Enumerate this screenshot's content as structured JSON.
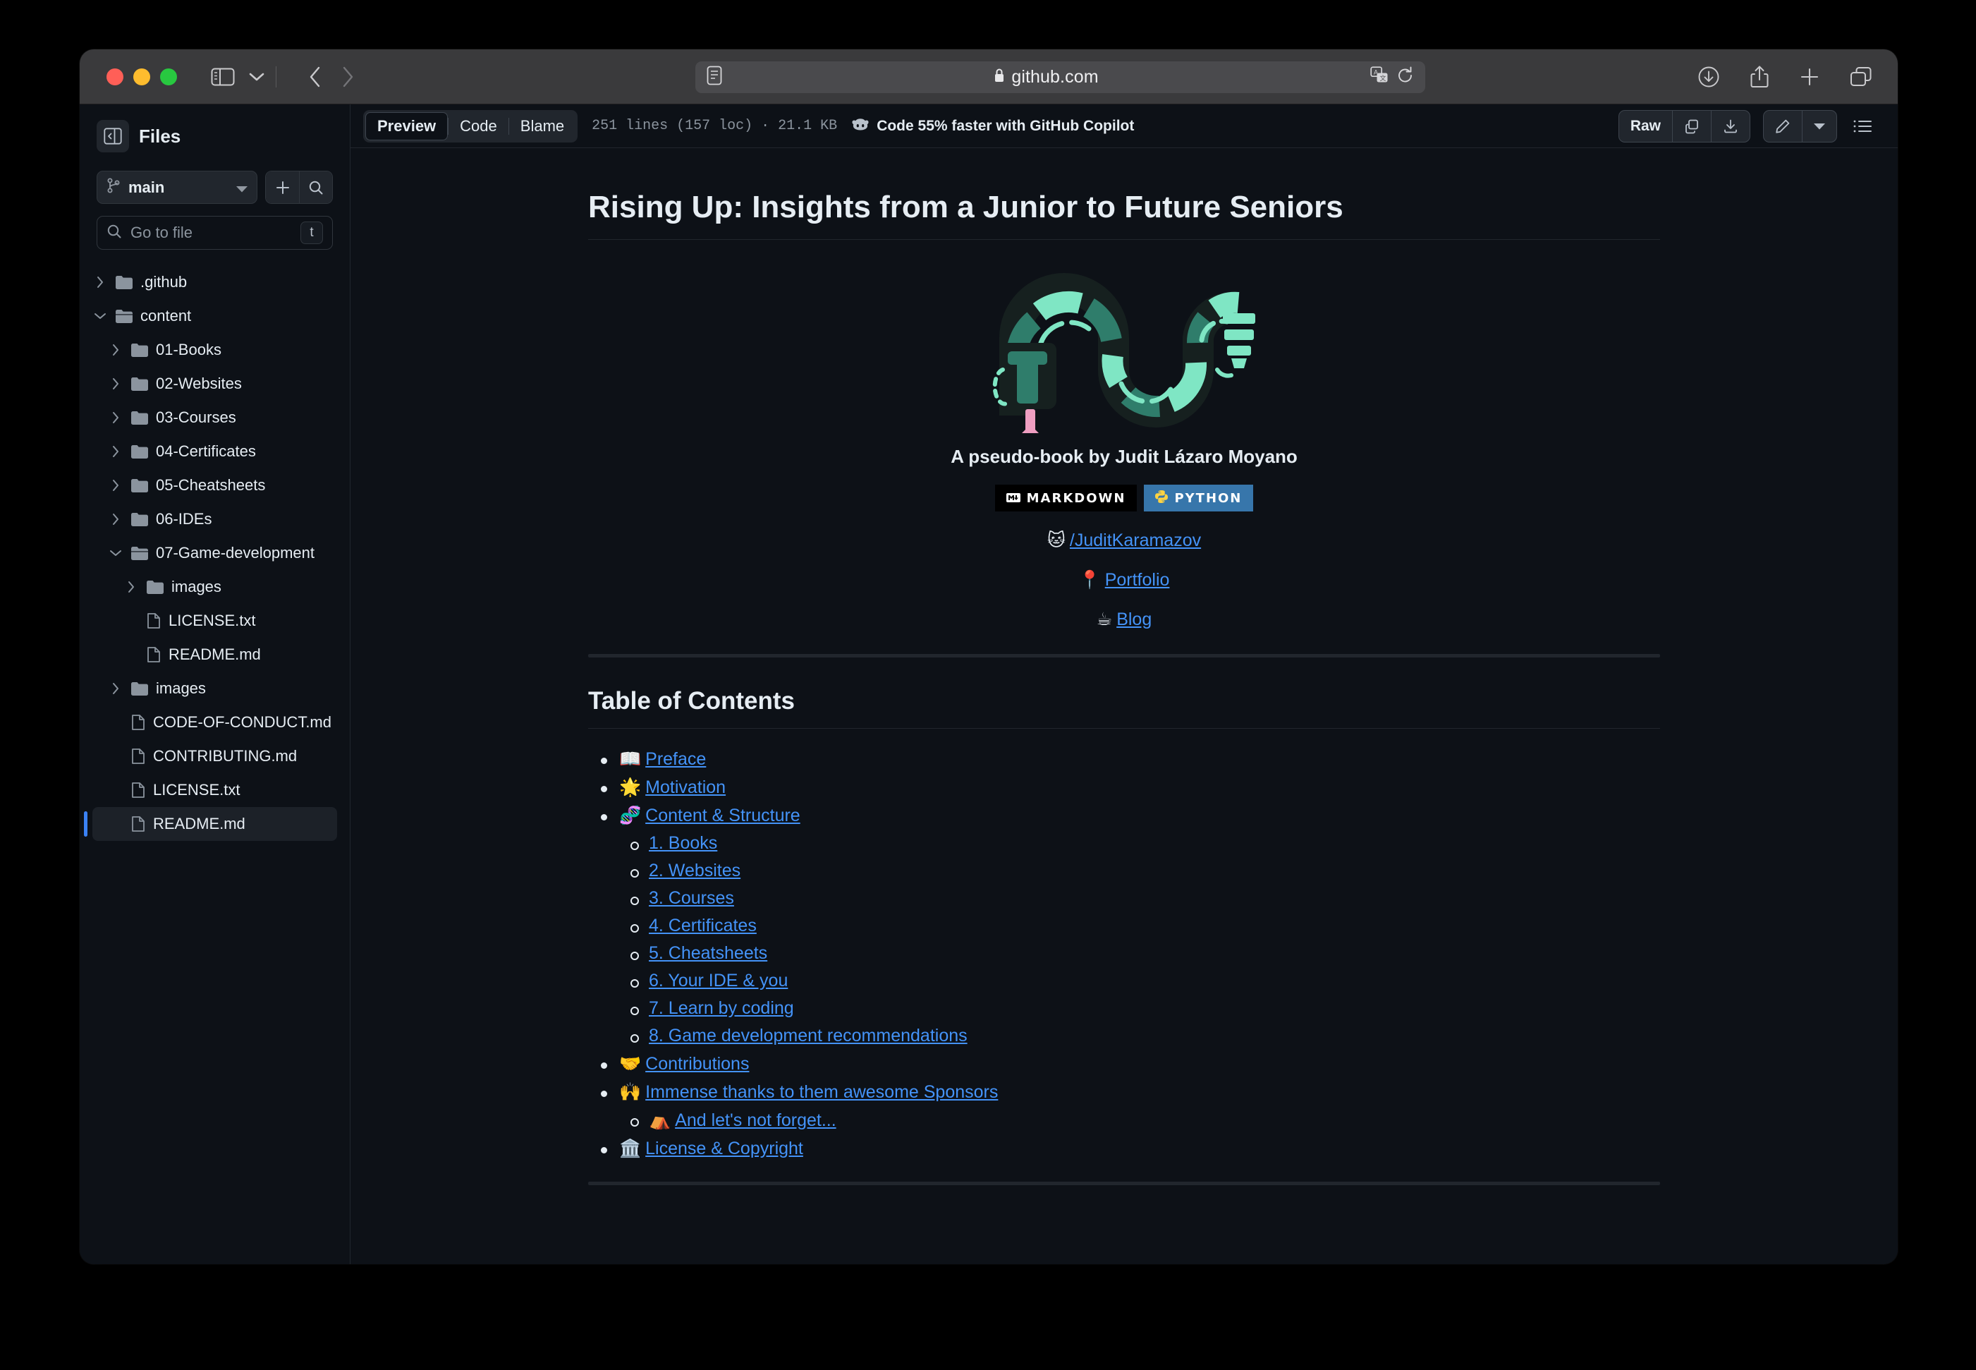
{
  "browser": {
    "url": "github.com",
    "url_lock_icon": "lock-icon",
    "reader_icon": "reader-view-icon",
    "translate_icon": "translate-icon",
    "reload_icon": "reload-icon",
    "sidebar_toggle_icon": "sidebar-toggle-icon",
    "chevron_down_icon": "chevron-down-icon",
    "back_icon": "back-chevron-icon",
    "forward_icon": "forward-chevron-icon",
    "downloads_icon": "downloads-icon",
    "share_icon": "share-icon",
    "new_tab_icon": "plus-icon",
    "tab_overview_icon": "tab-overview-icon"
  },
  "sidebar": {
    "title": "Files",
    "collapse_icon": "sidebar-collapse-icon",
    "branch": {
      "name": "main",
      "icon": "git-branch-icon",
      "caret": "chevron-down-icon"
    },
    "add_icon": "plus-icon",
    "search_icon": "search-icon",
    "search": {
      "placeholder": "Go to file",
      "icon": "search-icon",
      "shortcut": "t"
    },
    "tree": [
      {
        "label": ".github",
        "type": "folder",
        "state": "collapsed",
        "depth": 1,
        "selected": false
      },
      {
        "label": "content",
        "type": "folder",
        "state": "expanded",
        "depth": 1,
        "selected": false
      },
      {
        "label": "01-Books",
        "type": "folder",
        "state": "collapsed",
        "depth": 2,
        "selected": false
      },
      {
        "label": "02-Websites",
        "type": "folder",
        "state": "collapsed",
        "depth": 2,
        "selected": false
      },
      {
        "label": "03-Courses",
        "type": "folder",
        "state": "collapsed",
        "depth": 2,
        "selected": false
      },
      {
        "label": "04-Certificates",
        "type": "folder",
        "state": "collapsed",
        "depth": 2,
        "selected": false
      },
      {
        "label": "05-Cheatsheets",
        "type": "folder",
        "state": "collapsed",
        "depth": 2,
        "selected": false
      },
      {
        "label": "06-IDEs",
        "type": "folder",
        "state": "collapsed",
        "depth": 2,
        "selected": false
      },
      {
        "label": "07-Game-development",
        "type": "folder",
        "state": "expanded",
        "depth": 2,
        "selected": false
      },
      {
        "label": "images",
        "type": "folder",
        "state": "collapsed",
        "depth": 3,
        "selected": false
      },
      {
        "label": "LICENSE.txt",
        "type": "file",
        "state": "none",
        "depth": 3,
        "selected": false
      },
      {
        "label": "README.md",
        "type": "file",
        "state": "none",
        "depth": 3,
        "selected": false
      },
      {
        "label": "images",
        "type": "folder",
        "state": "collapsed",
        "depth": 2,
        "selected": false
      },
      {
        "label": "CODE-OF-CONDUCT.md",
        "type": "file",
        "state": "none",
        "depth": 2,
        "selected": false
      },
      {
        "label": "CONTRIBUTING.md",
        "type": "file",
        "state": "none",
        "depth": 2,
        "selected": false
      },
      {
        "label": "LICENSE.txt",
        "type": "file",
        "state": "none",
        "depth": 2,
        "selected": false
      },
      {
        "label": "README.md",
        "type": "file",
        "state": "none",
        "depth": 2,
        "selected": true
      }
    ]
  },
  "toolbar": {
    "tabs": [
      {
        "label": "Preview",
        "active": true
      },
      {
        "label": "Code",
        "active": false
      },
      {
        "label": "Blame",
        "active": false
      }
    ],
    "meta": "251 lines (157 loc) · 21.1 KB",
    "copilot_text": "Code 55% faster with GitHub Copilot",
    "copilot_icon": "copilot-icon",
    "raw_label": "Raw",
    "copy_icon": "copy-icon",
    "download_icon": "download-icon",
    "edit_icon": "pencil-icon",
    "edit_caret_icon": "chevron-down-icon",
    "outline_icon": "outline-list-icon"
  },
  "document": {
    "title": "Rising Up: Insights from a Junior to Future Seniors",
    "logo_alt": "snake-wave-logo",
    "byline": "A pseudo-book by Judit Lázaro Moyano",
    "badges": [
      {
        "label": "MARKDOWN",
        "icon": "markdown-icon",
        "color": "#000000"
      },
      {
        "label": "PYTHON",
        "icon": "python-icon",
        "color": "#3776ab"
      }
    ],
    "links": [
      {
        "emoji": "🐱",
        "label": "/JuditKaramazov",
        "icon_name": "cat-face-emoji"
      },
      {
        "emoji": "📍",
        "label": "Portfolio",
        "icon_name": "pushpin-emoji"
      },
      {
        "emoji": "☕",
        "label": "Blog",
        "icon_name": "coffee-emoji"
      }
    ],
    "toc_heading": "Table of Contents",
    "toc": [
      {
        "emoji": "📖",
        "label": "Preface",
        "icon_name": "open-book-emoji",
        "children": []
      },
      {
        "emoji": "🌟",
        "label": "Motivation",
        "icon_name": "glowing-star-emoji",
        "children": []
      },
      {
        "emoji": "🧬",
        "label": "Content & Structure",
        "icon_name": "dna-emoji",
        "children": [
          {
            "label": "1. Books"
          },
          {
            "label": "2. Websites"
          },
          {
            "label": "3. Courses"
          },
          {
            "label": "4. Certificates"
          },
          {
            "label": "5. Cheatsheets"
          },
          {
            "label": "6. Your IDE & you"
          },
          {
            "label": "7. Learn by coding"
          },
          {
            "label": "8. Game development recommendations"
          }
        ]
      },
      {
        "emoji": "🤝",
        "label": "Contributions",
        "icon_name": "handshake-emoji",
        "children": []
      },
      {
        "emoji": "🙌",
        "label": "Immense thanks to them awesome Sponsors",
        "icon_name": "raising-hands-emoji",
        "children": [
          {
            "emoji": "⛺",
            "label": "And let's not forget...",
            "icon_name": "tent-emoji"
          }
        ]
      },
      {
        "emoji": "🏛️",
        "label": "License & Copyright",
        "icon_name": "classical-building-emoji",
        "children": []
      }
    ]
  },
  "colors": {
    "page_bg": "#0d1117",
    "border": "#21262d",
    "link": "#4493f8",
    "accent_selected": "#3b82f6",
    "logo_mint": "#7fe6c4",
    "logo_teal": "#2f7d6b",
    "logo_pink": "#ef9ec1",
    "titlebar": "#3a3a3c"
  }
}
